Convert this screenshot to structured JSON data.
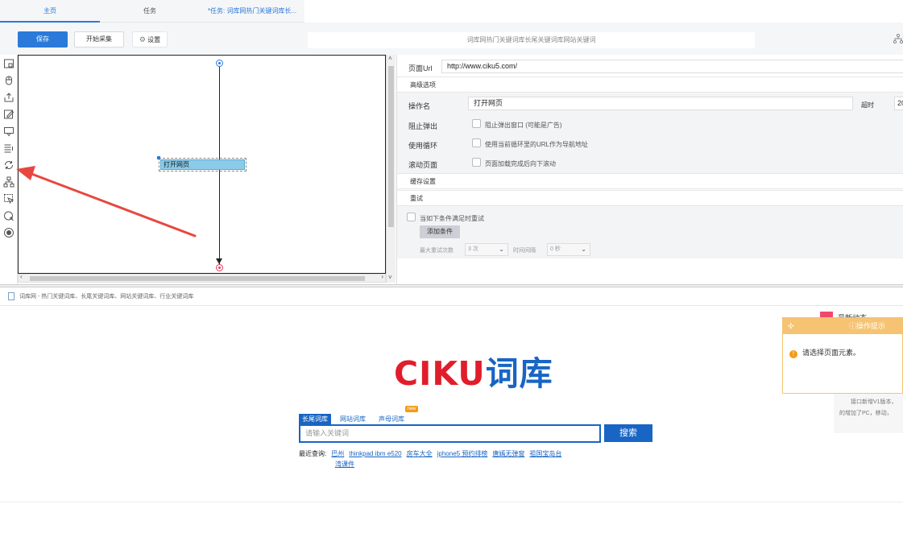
{
  "tabs": {
    "home": "主页",
    "tasks": "任务",
    "current_task": "*任务: 词库网热门关键词库长..."
  },
  "toolbar": {
    "save": "保存",
    "start_collect": "开始采集",
    "settings": "设置",
    "task_title": "词库网热门关键词库长尾关键词库网站关键词"
  },
  "canvas": {
    "step_label": "打开网页"
  },
  "props": {
    "url_label": "页面Url",
    "url_value": "http://www.ciku5.com/",
    "advanced": "高级选项",
    "op_name_label": "操作名",
    "op_name_value": "打开网页",
    "timeout_label": "超时",
    "timeout_value": "20",
    "block_popup_label": "阻止弹出",
    "block_popup_text": "阻止弹出窗口 (可能是广告)",
    "use_loop_label": "使用循环",
    "use_loop_text": "使用当前循环里的URL作为导航地址",
    "scroll_label": "滚动页面",
    "scroll_text": "页面加载完成后向下滚动",
    "cache": "缓存设置",
    "retry": "重试",
    "retry_when": "当如下条件满足时重试",
    "add_condition": "添加条件",
    "max_retry_label": "最大重试次数",
    "max_retry_value": "3 次",
    "interval_label": "时间间隔",
    "interval_value": "0 秒"
  },
  "browser": {
    "page_title": "词库网 - 热门关键词库、长尾关键词库、网站关键词库、行业关键词库",
    "logo_latin": "CIKU",
    "logo_cn": "词库",
    "search_tabs": [
      "长尾词库",
      "网站词库",
      "声母词库"
    ],
    "new_badge": "new",
    "search_placeholder": "请输入关键词",
    "search_button": "搜索",
    "recent_label": "最近查询:",
    "recent_items": [
      "巴州",
      "thinkpad ibm e520",
      "房车大全",
      "iphone5 预约排榜",
      "唐嫣无弹窗",
      "祖国宝岛台"
    ],
    "recent_item_line2": "湾课件",
    "news_title": "最新动态",
    "news_line1": "接口新增V1版本，",
    "news_line2": "的增加了PC，移动，"
  },
  "popup": {
    "title": "操作提示",
    "message": "请选择页面元素。"
  },
  "colors": {
    "accent": "#2b7ad9",
    "logo_red": "#e21d2b",
    "logo_blue": "#1865c4",
    "popup_orange": "#f5c372",
    "annotation_red": "#e8473f"
  }
}
